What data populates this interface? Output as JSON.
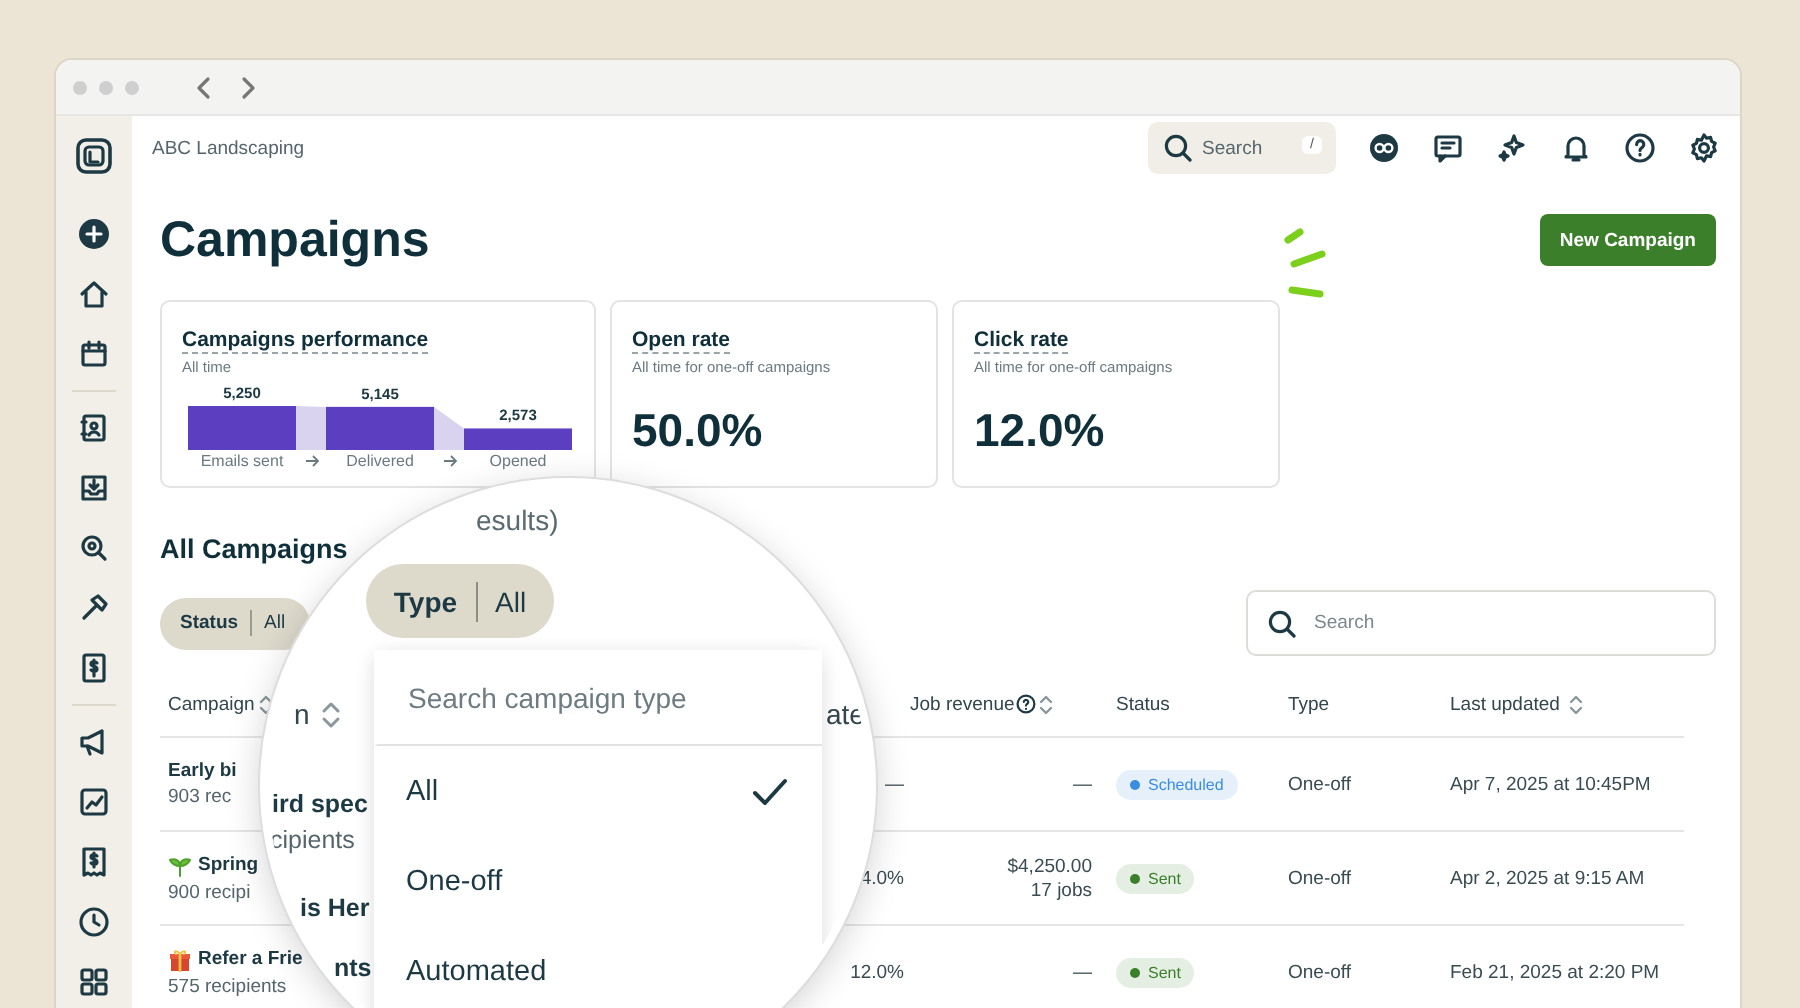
{
  "window": {
    "org_name": "ABC Landscaping"
  },
  "top_bar": {
    "search": {
      "placeholder": "Search",
      "shortcut": "/"
    }
  },
  "page": {
    "title": "Campaigns",
    "primary_button": "New Campaign"
  },
  "cards": [
    {
      "kind": "chart",
      "title": "Campaigns performance",
      "subtitle": "All time",
      "chart_data": {
        "type": "bar",
        "categories": [
          "Emails sent",
          "Delivered",
          "Opened"
        ],
        "values": [
          5250,
          5145,
          2573
        ],
        "value_labels": [
          "5,250",
          "5,145",
          "2,573"
        ]
      }
    },
    {
      "kind": "stat",
      "title": "Open rate",
      "subtitle": "All time for one-off campaigns",
      "value": "50.0%"
    },
    {
      "kind": "stat",
      "title": "Click rate",
      "subtitle": "All time for one-off campaigns",
      "value": "12.0%"
    }
  ],
  "section_title": "All Campaigns",
  "filters": [
    {
      "label": "Status",
      "value": "All"
    }
  ],
  "table_search": {
    "placeholder": "Search"
  },
  "table": {
    "columns": [
      {
        "label": "Campaign",
        "sortable": true,
        "help": false
      },
      {
        "label": "Job revenue",
        "sortable": true,
        "help": true
      },
      {
        "label": "Status",
        "sortable": false,
        "help": false
      },
      {
        "label": "Type",
        "sortable": false,
        "help": false
      },
      {
        "label": "Last updated",
        "sortable": true,
        "help": false
      }
    ],
    "rows": [
      {
        "kind": "plain",
        "name": "Early bi",
        "recipients": "903 rec",
        "rate": "—",
        "revenue": "—",
        "status": {
          "label": "Scheduled",
          "color": "#3b8de0"
        },
        "type": "One-off",
        "updated": "Apr 7, 2025 at 10:45PM"
      },
      {
        "kind": "sprout",
        "name": "Spring",
        "recipients": "900 recipi",
        "rate": "4.0%",
        "revenue": "$4,250.00",
        "jobs": "17 jobs",
        "status": {
          "label": "Sent",
          "color": "#3a7f2a"
        },
        "type": "One-off",
        "updated": "Apr 2, 2025 at 9:15 AM"
      },
      {
        "kind": "gift",
        "name": "Refer a Frie",
        "recipients": "575 recipients",
        "rate": "12.0%",
        "revenue": "—",
        "status": {
          "label": "Sent",
          "color": "#3a7f2a"
        },
        "type": "One-off",
        "updated": "Feb 21, 2025 at 2:20 PM"
      }
    ]
  },
  "magnifier": {
    "count_text": "esults)",
    "type_filter": {
      "label": "Type",
      "value": "All"
    },
    "column_fragment": "n",
    "rate_fragment": "ate",
    "row_fragments": [
      {
        "kind": "name",
        "text": "ird spec"
      },
      {
        "kind": "sub",
        "text": "cipients"
      },
      {
        "kind": "name",
        "text": "is Her"
      },
      {
        "kind": "name",
        "text": "nts"
      }
    ],
    "dropdown": {
      "placeholder": "Search campaign type",
      "options": [
        {
          "label": "All",
          "selected": true
        },
        {
          "label": "One-off",
          "selected": false
        },
        {
          "label": "Automated",
          "selected": false
        }
      ]
    }
  }
}
